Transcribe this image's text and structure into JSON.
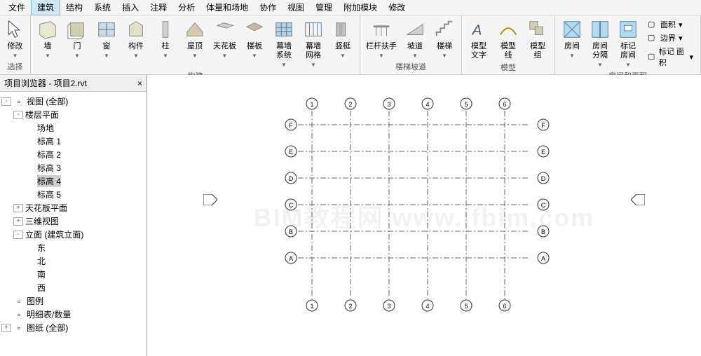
{
  "menu": [
    "文件",
    "建筑",
    "结构",
    "系统",
    "插入",
    "注释",
    "分析",
    "体量和场地",
    "协作",
    "视图",
    "管理",
    "附加模块",
    "修改"
  ],
  "menu_active_index": 1,
  "ribbon": {
    "select": {
      "modify": "修改",
      "label": "选择"
    },
    "build": {
      "buttons": [
        "墙",
        "门",
        "窗",
        "构件",
        "柱",
        "屋顶",
        "天花板",
        "楼板",
        "幕墙\n系统",
        "幕墙\n网格",
        "竖梃"
      ],
      "label": "构建"
    },
    "circ": {
      "buttons": [
        "栏杆扶手",
        "坡道",
        "楼梯"
      ],
      "label": "楼梯坡道"
    },
    "model": {
      "buttons": [
        "模型\n文字",
        "模型\n线",
        "模型\n组"
      ],
      "label": "模型"
    },
    "room": {
      "buttons": [
        "房间",
        "房间\n分隔",
        "标记\n房间"
      ],
      "small": [
        "面积",
        "边界",
        "标记 面积"
      ],
      "label": "房间和面积"
    }
  },
  "browser": {
    "title": "项目浏览器 - 项目2.rvt",
    "close": "×",
    "tree": [
      {
        "indent": 0,
        "toggle": "-",
        "icon": "views",
        "label": "视图 (全部)"
      },
      {
        "indent": 1,
        "toggle": "-",
        "icon": "",
        "label": "楼层平面"
      },
      {
        "indent": 2,
        "toggle": "",
        "icon": "",
        "label": "场地"
      },
      {
        "indent": 2,
        "toggle": "",
        "icon": "",
        "label": "标高 1"
      },
      {
        "indent": 2,
        "toggle": "",
        "icon": "",
        "label": "标高 2"
      },
      {
        "indent": 2,
        "toggle": "",
        "icon": "",
        "label": "标高 3"
      },
      {
        "indent": 2,
        "toggle": "",
        "icon": "",
        "label": "标高 4",
        "selected": true
      },
      {
        "indent": 2,
        "toggle": "",
        "icon": "",
        "label": "标高 5"
      },
      {
        "indent": 1,
        "toggle": "+",
        "icon": "",
        "label": "天花板平面"
      },
      {
        "indent": 1,
        "toggle": "+",
        "icon": "",
        "label": "三维视图"
      },
      {
        "indent": 1,
        "toggle": "-",
        "icon": "",
        "label": "立面 (建筑立面)"
      },
      {
        "indent": 2,
        "toggle": "",
        "icon": "",
        "label": "东"
      },
      {
        "indent": 2,
        "toggle": "",
        "icon": "",
        "label": "北"
      },
      {
        "indent": 2,
        "toggle": "",
        "icon": "",
        "label": "南"
      },
      {
        "indent": 2,
        "toggle": "",
        "icon": "",
        "label": "西"
      },
      {
        "indent": 0,
        "toggle": "",
        "icon": "legend",
        "label": "图例"
      },
      {
        "indent": 0,
        "toggle": "",
        "icon": "sched",
        "label": "明细表/数量"
      },
      {
        "indent": 0,
        "toggle": "+",
        "icon": "sheet",
        "label": "图纸 (全部)"
      }
    ]
  },
  "watermark": "BIM教程网 www.ifbim.com",
  "grid": {
    "cols": [
      "1",
      "2",
      "3",
      "4",
      "5",
      "6"
    ],
    "rows": [
      "F",
      "E",
      "D",
      "C",
      "B",
      "A"
    ]
  }
}
